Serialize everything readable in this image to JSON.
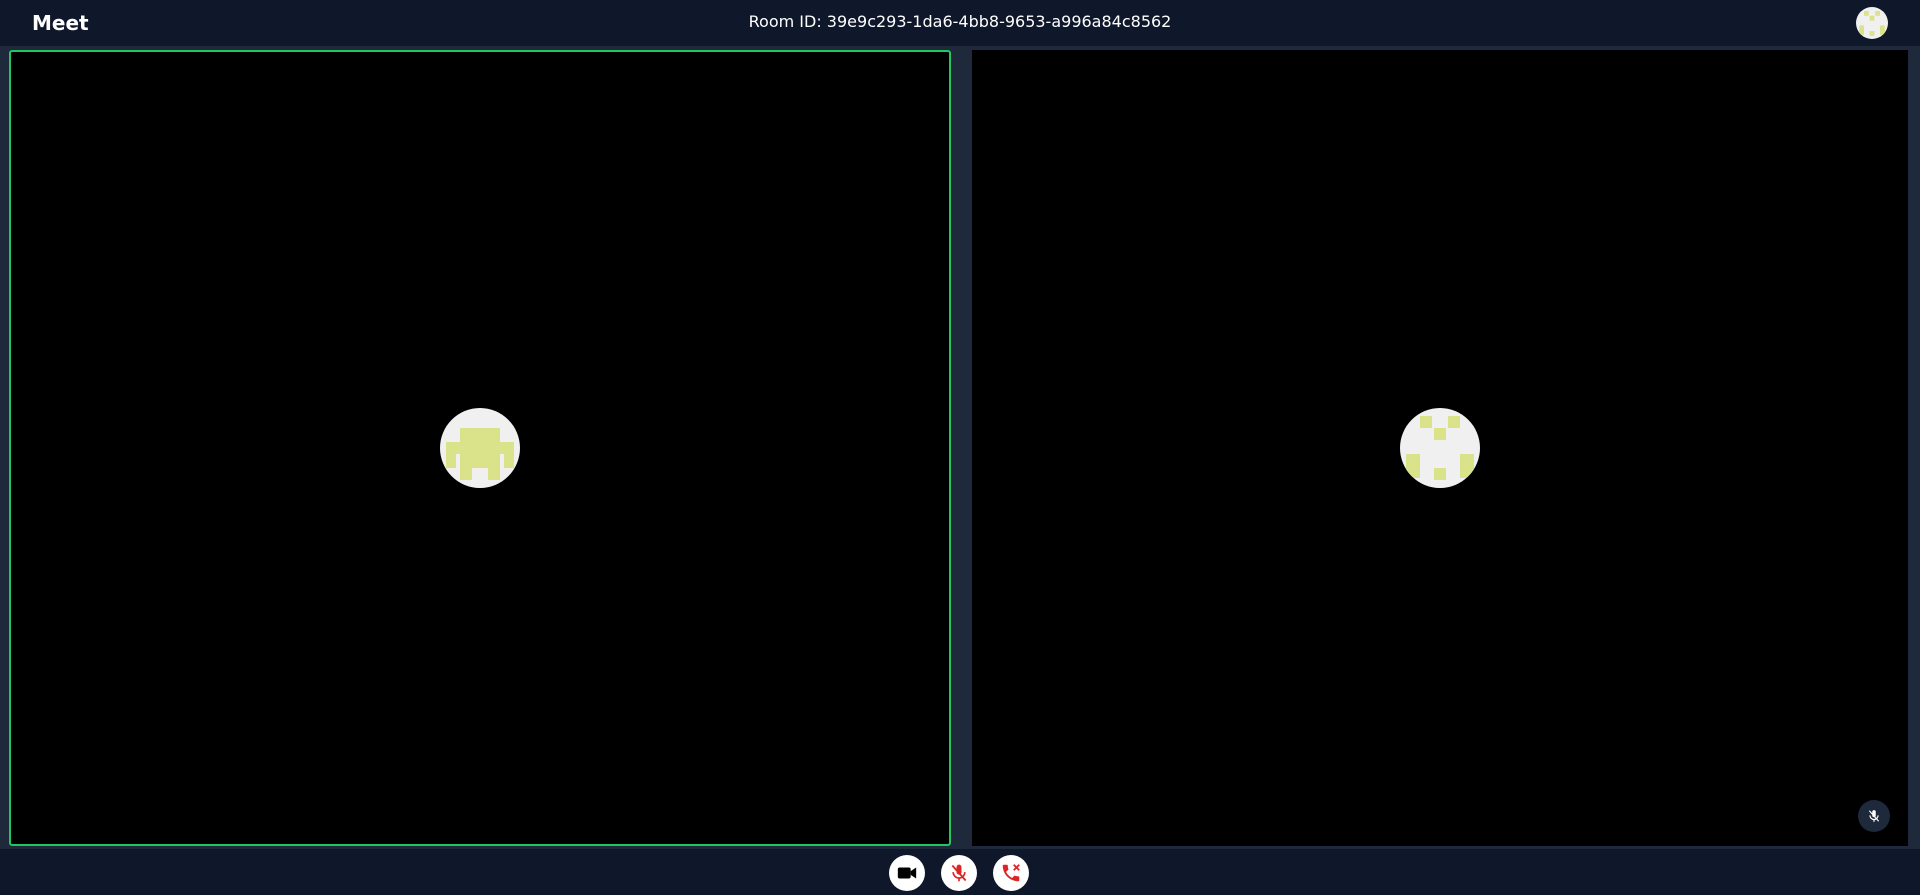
{
  "header": {
    "brand": "Meet",
    "room_id": "Room ID: 39e9c293-1da6-4bb8-9653-a996a84c8562",
    "user_avatar_icon": "identicon-avatar"
  },
  "tiles": [
    {
      "id": "local",
      "avatar_icon": "identicon-avatar",
      "active_speaker": true,
      "highlight_color": "#22c55e"
    },
    {
      "id": "remote",
      "avatar_icon": "identicon-avatar",
      "muted": true,
      "status_icon": "mic-off-icon"
    }
  ],
  "controls": {
    "camera": {
      "icon": "video-camera-icon",
      "state": "on"
    },
    "microphone": {
      "icon": "mic-off-icon",
      "state": "muted"
    },
    "leave": {
      "icon": "phone-hangup-icon"
    }
  },
  "colors": {
    "topbar_bg": "#0f172a",
    "stage_bg": "#1e293b",
    "tile_bg": "#000000",
    "active_border": "#22c55e",
    "avatar_bg": "#f0f0f0",
    "identicon": "#dbe38a",
    "danger": "#dc2626"
  }
}
